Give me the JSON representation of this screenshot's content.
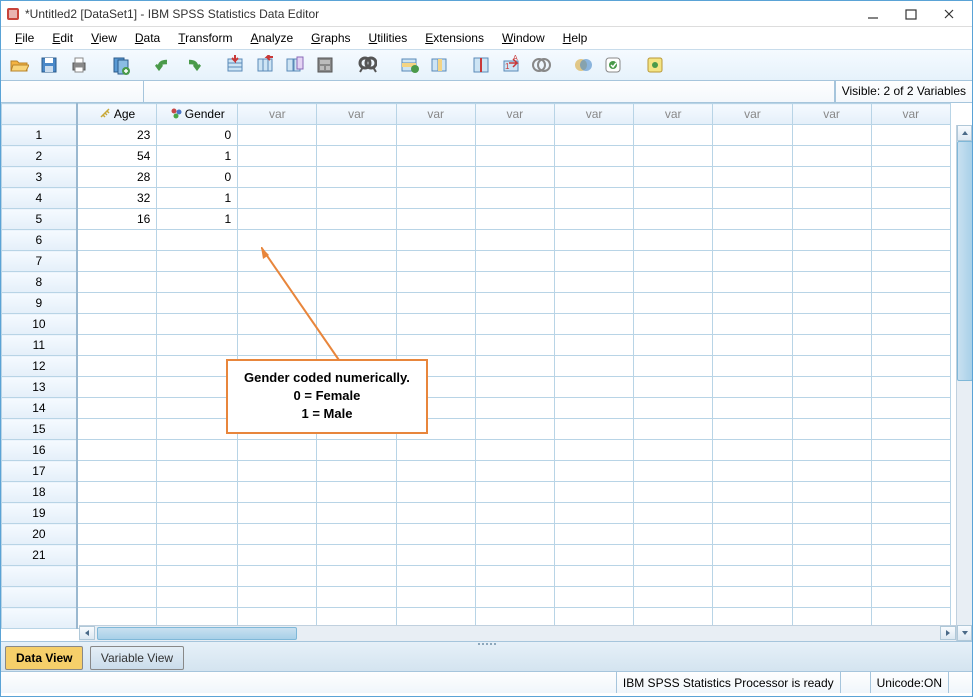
{
  "titlebar": {
    "title": "*Untitled2 [DataSet1] - IBM SPSS Statistics Data Editor"
  },
  "menus": [
    "File",
    "Edit",
    "View",
    "Data",
    "Transform",
    "Analyze",
    "Graphs",
    "Utilities",
    "Extensions",
    "Window",
    "Help"
  ],
  "toolbar_icons": [
    "open",
    "save",
    "print",
    "sep",
    "recall",
    "sep",
    "undo",
    "redo",
    "sep",
    "goto-case",
    "goto-var",
    "variables",
    "run-stats",
    "sep",
    "find",
    "sep",
    "insert-case",
    "insert-var",
    "sep",
    "split",
    "weight",
    "select",
    "sep",
    "value-labels",
    "use-sets",
    "sep",
    "add-on"
  ],
  "visible_text": "Visible: 2 of 2 Variables",
  "columns": [
    {
      "name": "Age",
      "type": "scale"
    },
    {
      "name": "Gender",
      "type": "nominal"
    }
  ],
  "var_placeholder": "var",
  "rows": [
    {
      "n": 1,
      "Age": 23,
      "Gender": 0
    },
    {
      "n": 2,
      "Age": 54,
      "Gender": 1
    },
    {
      "n": 3,
      "Age": 28,
      "Gender": 0
    },
    {
      "n": 4,
      "Age": 32,
      "Gender": 1
    },
    {
      "n": 5,
      "Age": 16,
      "Gender": 1
    }
  ],
  "empty_rows": [
    6,
    7,
    8,
    9,
    10,
    11,
    12,
    13,
    14,
    15,
    16,
    17,
    18,
    19,
    20,
    21
  ],
  "tabs": {
    "dataview": "Data View",
    "varview": "Variable View"
  },
  "status": {
    "processor": "IBM SPSS Statistics Processor is ready",
    "unicode": "Unicode:ON"
  },
  "callout": {
    "line1": "Gender coded numerically.",
    "line2": "0 = Female",
    "line3": "1 = Male"
  }
}
